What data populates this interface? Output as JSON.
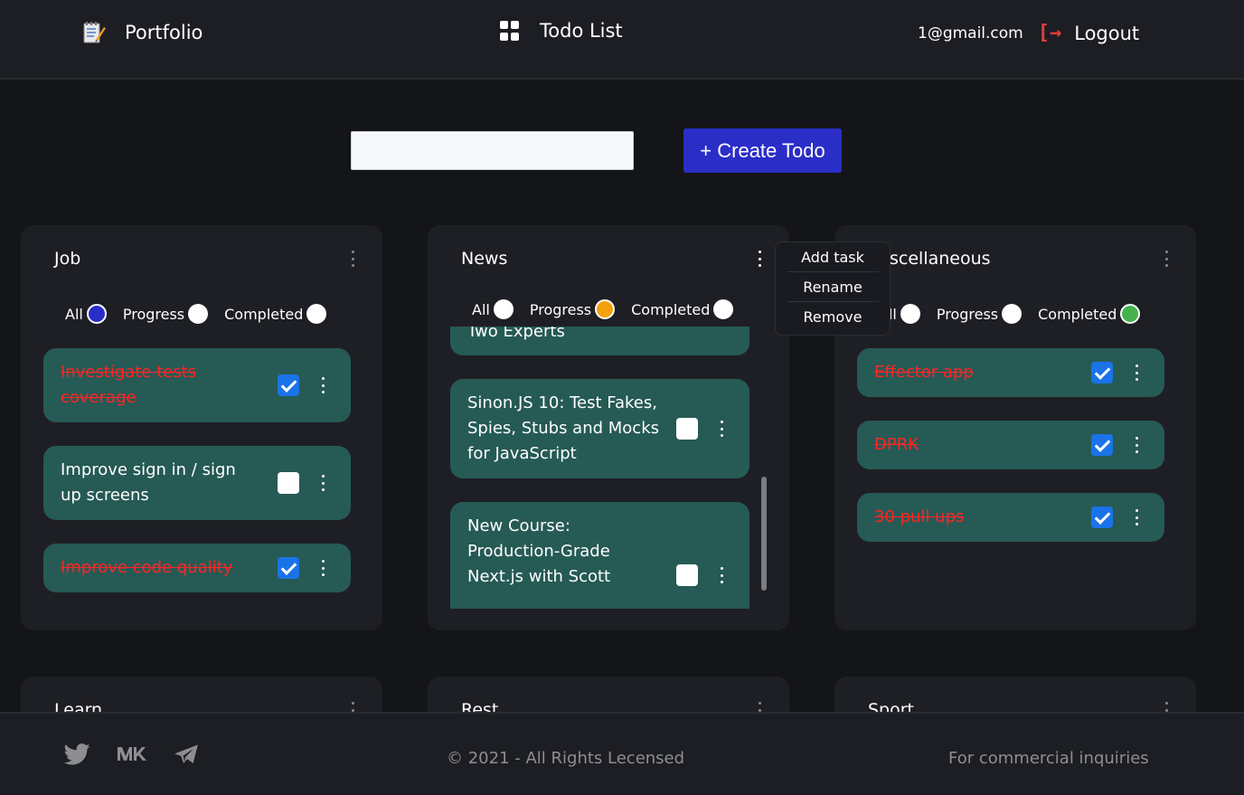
{
  "header": {
    "brand": "Portfolio",
    "nav_title": "Todo List",
    "email": "1@gmail.com",
    "logout": "Logout"
  },
  "create": {
    "input_value": "",
    "button_label": "+ Create Todo"
  },
  "filters": {
    "all": "All",
    "progress": "Progress",
    "completed": "Completed"
  },
  "boards": [
    {
      "title": "Job",
      "selected_filter": "All",
      "tasks": [
        {
          "text": "Investigate tests coverage",
          "done": true
        },
        {
          "text": "Improve sign in / sign up screens",
          "done": false
        },
        {
          "text": "Improve code quality",
          "done": true
        }
      ]
    },
    {
      "title": "News",
      "selected_filter": "Progress",
      "tasks": [
        {
          "text": "Two Experts",
          "done": false
        },
        {
          "text": "Sinon.JS 10: Test Fakes, Spies, Stubs and Mocks for JavaScript",
          "done": false
        },
        {
          "text": "New Course: Production-Grade Next.js with Scott",
          "done": false
        }
      ]
    },
    {
      "title": "scellaneous",
      "selected_filter": "Completed",
      "tasks": [
        {
          "text": "Effector app",
          "done": true
        },
        {
          "text": "DPRK",
          "done": true
        },
        {
          "text": "30 pull ups",
          "done": true
        }
      ]
    },
    {
      "title": "Learn"
    },
    {
      "title": "Rest"
    },
    {
      "title": "Sport"
    }
  ],
  "board_menu": {
    "items": [
      "Add task",
      "Rename",
      "Remove"
    ]
  },
  "colors": {
    "filter_all": "#2a2dc7",
    "filter_progress": "#f5a10d",
    "filter_completed": "#44b34c",
    "task_bg": "#265a55",
    "done_text": "#ff2424",
    "accent": "#2b2dc7"
  },
  "footer": {
    "social_icons": [
      "twitter-icon",
      "vk-icon",
      "telegram-icon"
    ],
    "copyright": "© 2021 - All Rights Lecensed",
    "inquiry": "For commercial inquiries"
  }
}
